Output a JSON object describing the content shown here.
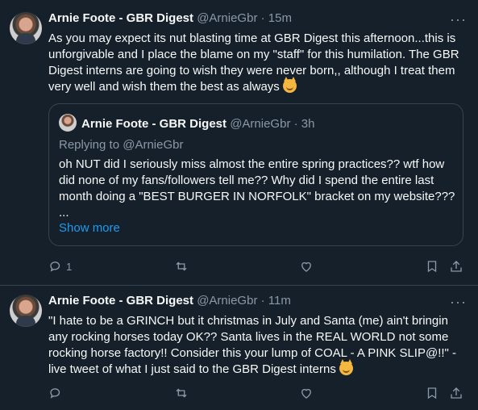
{
  "tweets": [
    {
      "author": "Arnie Foote - GBR Digest",
      "handle": "@ArnieGbr",
      "time": "· 15m",
      "text": "As you may expect its nut blasting time at GBR Digest this afternoon...this is unforgivable and I place the blame on my \"staff\" for this humilation. The GBR Digest interns are going to wish they were never born,, although I treat them very well and wish them the best as always",
      "quote": {
        "author": "Arnie Foote - GBR Digest",
        "handle": "@ArnieGbr",
        "time": "· 3h",
        "replying_to": "Replying to @ArnieGbr",
        "text_line1": "oh NUT did I seriously miss almost the entire spring practices?? wtf how did none of my fans/followers tell me?? Why did I spend the entire last month doing a \"BEST BURGER IN NORFOLK\" bracket on my website???",
        "ellipsis": "...",
        "show_more": "Show more"
      },
      "reply_count": "1"
    },
    {
      "author": "Arnie Foote - GBR Digest",
      "handle": "@ArnieGbr",
      "time": "· 11m",
      "text": "\"I hate to be a GRINCH but it christmas in July and Santa (me) ain't bringin any rocking horses today OK?? Santa lives in the REAL WORLD not some rocking horse factory!! Consider this your lump of COAL - A PINK SLIP@!!\" -live tweet of what I just said to the GBR Digest interns",
      "reply_count": ""
    }
  ],
  "more_glyph": "···",
  "colors": {
    "background": "#15202b",
    "muted": "#8b98a5",
    "link": "#1d9bf0",
    "border": "#38444d"
  },
  "icons": [
    "avatar",
    "more-icon",
    "reply-icon",
    "retweet-icon",
    "like-icon",
    "bookmark-icon",
    "share-icon",
    "devil-emoji"
  ]
}
